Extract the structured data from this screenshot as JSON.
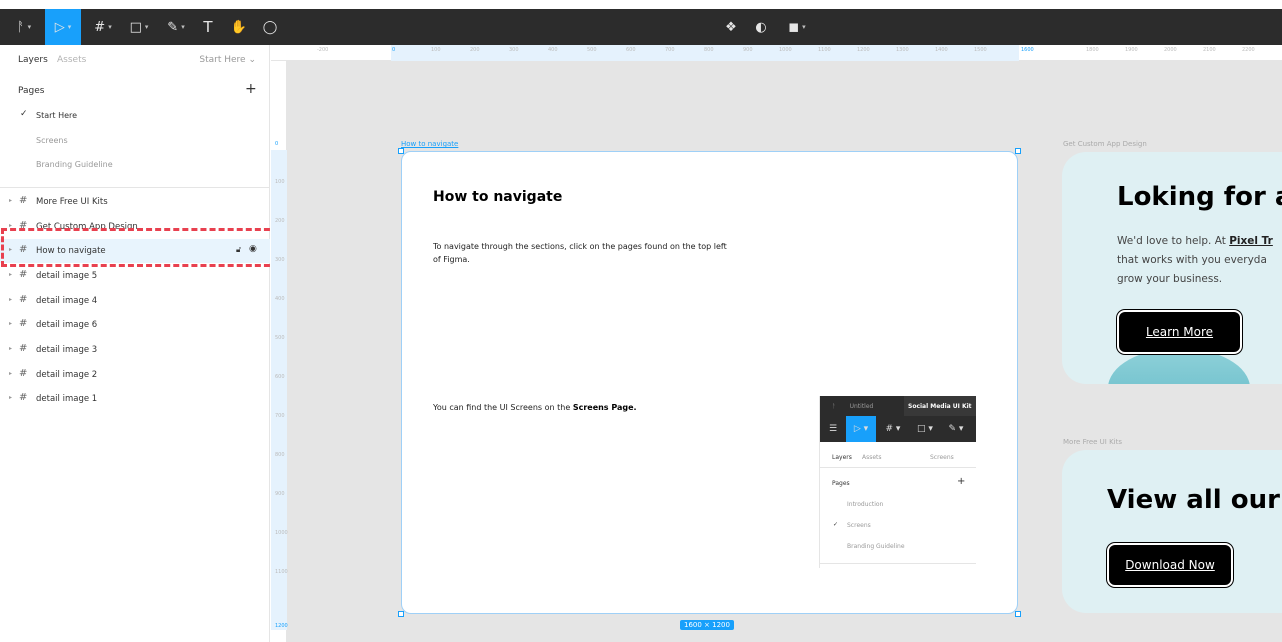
{
  "toolbar": {
    "tools": [
      {
        "name": "main-menu",
        "glyph": "ᚨ"
      },
      {
        "name": "move-tool",
        "glyph": "▷"
      },
      {
        "name": "frame-tool",
        "glyph": "#"
      },
      {
        "name": "shape-tool",
        "glyph": "□"
      },
      {
        "name": "pen-tool",
        "glyph": "✎"
      },
      {
        "name": "text-tool",
        "glyph": "T"
      },
      {
        "name": "hand-tool",
        "glyph": "✋"
      },
      {
        "name": "comment-tool",
        "glyph": "◯"
      }
    ],
    "center_icons": [
      "component-icon",
      "contrast-icon",
      "boolean-icon"
    ]
  },
  "left_panel": {
    "tabs": {
      "layers": "Layers",
      "assets": "Assets"
    },
    "current_page": "Start Here",
    "pages_header": "Pages",
    "add_page": "+",
    "pages": [
      {
        "label": "Start Here",
        "current": true
      },
      {
        "label": "Screens",
        "current": false
      },
      {
        "label": "Branding Guideline",
        "current": false
      }
    ],
    "layers": [
      {
        "label": "More Free UI Kits",
        "selected": false
      },
      {
        "label": "Get Custom App Design",
        "selected": false
      },
      {
        "label": "How to navigate",
        "selected": true
      },
      {
        "label": "detail image 5",
        "selected": false
      },
      {
        "label": "detail image 4",
        "selected": false
      },
      {
        "label": "detail image 6",
        "selected": false
      },
      {
        "label": "detail image 3",
        "selected": false
      },
      {
        "label": "detail image 2",
        "selected": false
      },
      {
        "label": "detail image 1",
        "selected": false
      }
    ]
  },
  "rulers": {
    "top": [
      "-200",
      "0",
      "100",
      "200",
      "300",
      "400",
      "500",
      "600",
      "700",
      "800",
      "900",
      "1000",
      "1100",
      "1200",
      "1300",
      "1400",
      "1500",
      "1600",
      "1800",
      "1900",
      "2000",
      "2100",
      "2200"
    ],
    "left": [
      "0",
      "100",
      "200",
      "300",
      "400",
      "500",
      "600",
      "700",
      "800",
      "900",
      "1000",
      "1100",
      "1200"
    ]
  },
  "canvas": {
    "main_frame": {
      "title": "How to navigate",
      "size_label": "1600 × 1200",
      "heading": "How to navigate",
      "instructions": "To navigate through the sections, click on the pages found on the top left of Figma.",
      "screens_text_prefix": "You can find the UI Screens on the ",
      "screens_text_bold": "Screens Page.",
      "mini_figma": {
        "tabs": [
          "Untitled",
          "Social Media UI Kit"
        ],
        "layers_tab": "Layers",
        "assets_tab": "Assets",
        "page_select": "Screens",
        "pages_header": "Pages",
        "add": "+",
        "pages": [
          "Introduction",
          "Screens",
          "Branding Guideline"
        ]
      }
    },
    "custom_card": {
      "title": "Get Custom App Design",
      "heading": "Loking for a",
      "text_line1_prefix": "We'd love to help. At ",
      "text_line1_bold": "Pixel Tr",
      "text_line2": "that works with you everyda",
      "text_line3": "grow your business.",
      "button": "Learn More"
    },
    "free_card": {
      "title": "More Free UI Kits",
      "heading": "View all our F",
      "button": "Download Now"
    }
  },
  "colors": {
    "accent": "#18a0fb",
    "toolbar": "#2c2c2c",
    "canvas": "#e5e5e5",
    "card": "#dff0f3",
    "highlight": "#e8404f"
  }
}
